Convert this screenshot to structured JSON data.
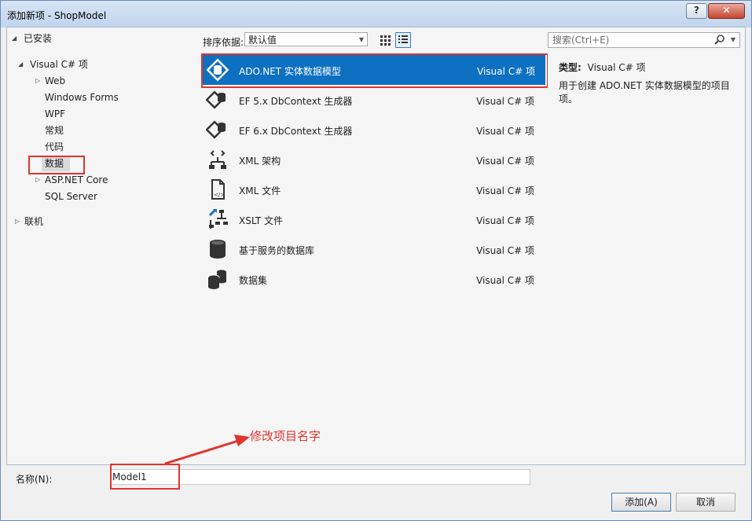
{
  "window": {
    "title": "添加新项 - ShopModel",
    "help_label": "?",
    "close_label": "✕"
  },
  "tree": {
    "installed": "已安装",
    "visual_csharp": "Visual C# 项",
    "web": "Web",
    "windows_forms": "Windows Forms",
    "wpf": "WPF",
    "general": "常规",
    "code": "代码",
    "data": "数据",
    "aspnet_core": "ASP.NET Core",
    "sql_server": "SQL Server",
    "online": "联机"
  },
  "toolbar": {
    "sort_label": "排序依据:",
    "sort_value": "默认值"
  },
  "items": [
    {
      "name": "ADO.NET 实体数据模型",
      "lang": "Visual C# 项",
      "icon": "entity-model-icon"
    },
    {
      "name": "EF 5.x DbContext 生成器",
      "lang": "Visual C# 项",
      "icon": "dbcontext-generator-icon"
    },
    {
      "name": "EF 6.x DbContext 生成器",
      "lang": "Visual C# 项",
      "icon": "dbcontext-generator-icon"
    },
    {
      "name": "XML 架构",
      "lang": "Visual C# 项",
      "icon": "xml-schema-icon"
    },
    {
      "name": "XML 文件",
      "lang": "Visual C# 项",
      "icon": "xml-file-icon"
    },
    {
      "name": "XSLT 文件",
      "lang": "Visual C# 项",
      "icon": "xslt-file-icon"
    },
    {
      "name": "基于服务的数据库",
      "lang": "Visual C# 项",
      "icon": "database-icon"
    },
    {
      "name": "数据集",
      "lang": "Visual C# 项",
      "icon": "dataset-icon"
    }
  ],
  "search": {
    "placeholder": "搜索(Ctrl+E)"
  },
  "details": {
    "type_label": "类型:",
    "type_value": "Visual C# 项",
    "description": "用于创建 ADO.NET 实体数据模型的项目项。"
  },
  "form": {
    "name_label": "名称(N):",
    "name_value": "Model1"
  },
  "annotation": {
    "text": "修改项目名字"
  },
  "buttons": {
    "add": "添加(A)",
    "cancel": "取消"
  },
  "colors": {
    "selection": "#0e70c0",
    "annotation": "#e0342c"
  }
}
